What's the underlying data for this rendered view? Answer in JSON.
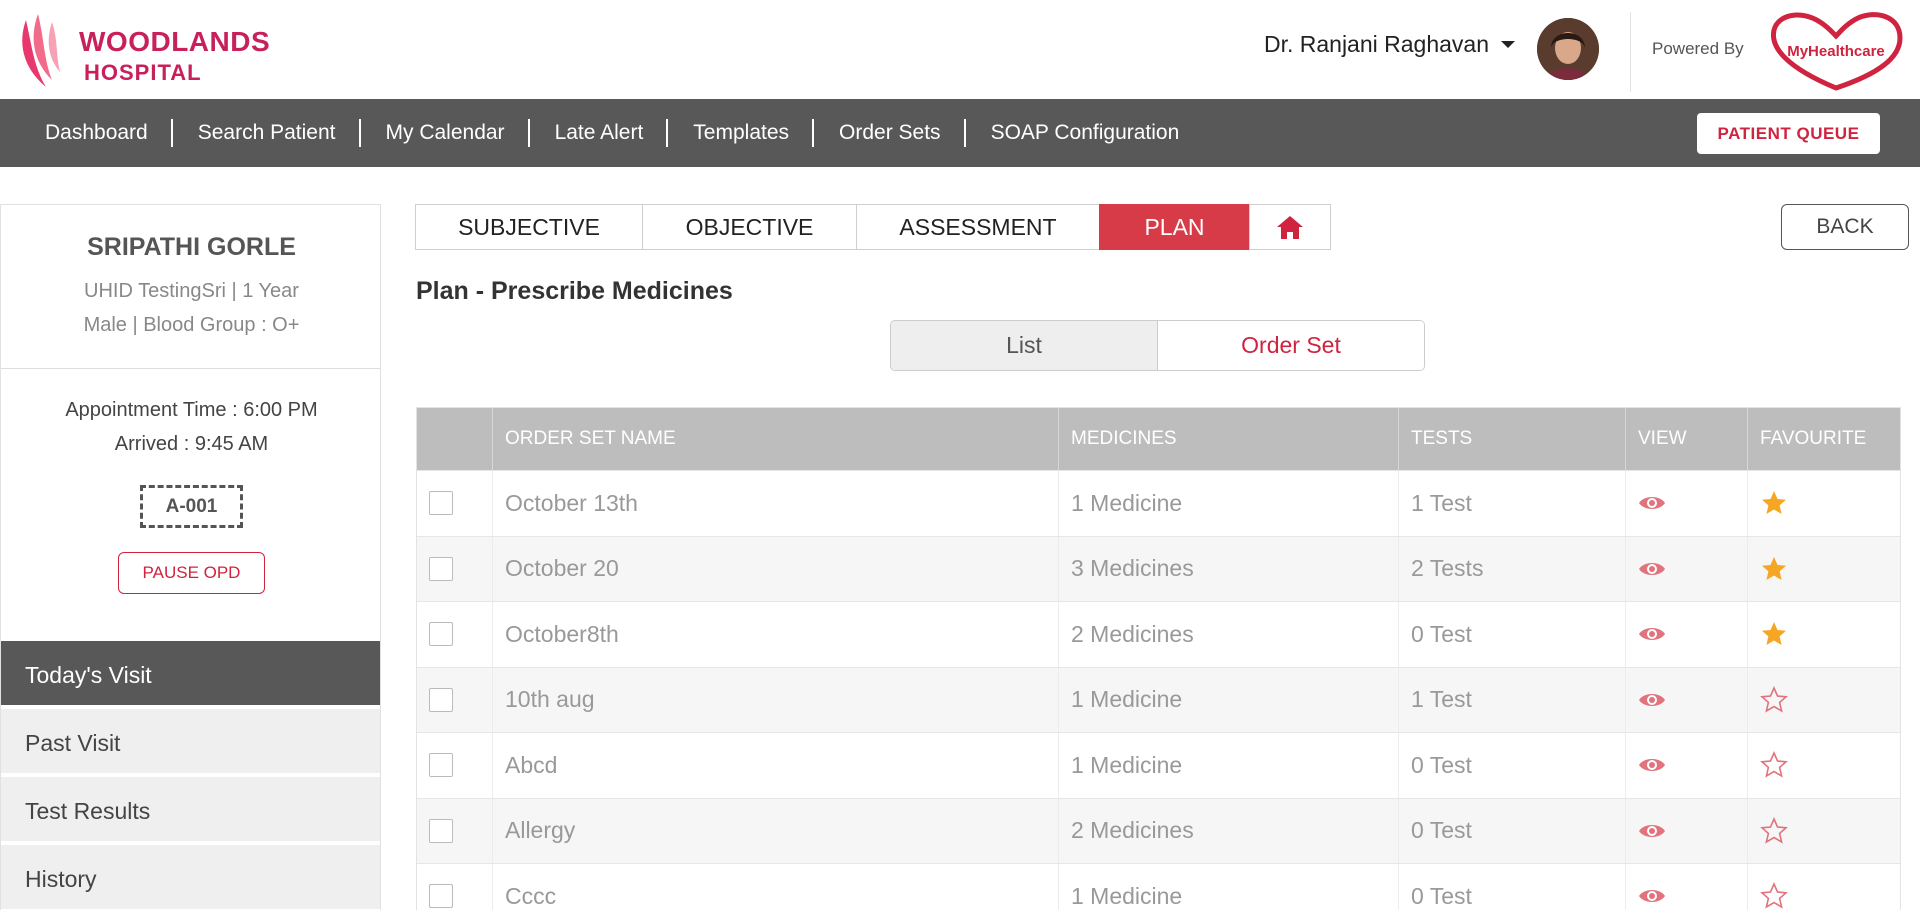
{
  "header": {
    "logo_line1": "WOODLANDS",
    "logo_line2": "HOSPITAL",
    "doctor_name": "Dr. Ranjani Raghavan",
    "powered_by": "Powered By",
    "partner_logo_text": "MyHealthcare"
  },
  "nav": {
    "items": [
      "Dashboard",
      "Search Patient",
      "My Calendar",
      "Late Alert",
      "Templates",
      "Order Sets",
      "SOAP Configuration"
    ],
    "queue_button": "PATIENT QUEUE"
  },
  "patient": {
    "name": "SRIPATHI GORLE",
    "uhid_line": "UHID TestingSri | 1 Year",
    "gender_line": "Male | Blood Group : O+",
    "appointment": "Appointment Time : 6:00 PM",
    "arrived": "Arrived : 9:45 AM",
    "token": "A-001",
    "pause_button": "PAUSE OPD"
  },
  "side_nav": [
    "Today's Visit",
    "Past Visit",
    "Test Results",
    "History"
  ],
  "tabs": [
    "SUBJECTIVE",
    "OBJECTIVE",
    "ASSESSMENT",
    "PLAN"
  ],
  "back_button": "BACK",
  "section_title": "Plan - Prescribe Medicines",
  "toggle": {
    "list": "List",
    "order_set": "Order Set"
  },
  "table": {
    "headers": [
      "ORDER SET NAME",
      "MEDICINES",
      "TESTS",
      "VIEW",
      "FAVOURITE"
    ],
    "rows": [
      {
        "name": "October 13th",
        "medicines": "1 Medicine",
        "tests": "1 Test",
        "favourite": true
      },
      {
        "name": "October 20",
        "medicines": "3 Medicines",
        "tests": "2 Tests",
        "favourite": true
      },
      {
        "name": "October8th",
        "medicines": "2 Medicines",
        "tests": "0 Test",
        "favourite": true
      },
      {
        "name": "10th aug",
        "medicines": "1 Medicine",
        "tests": "1 Test",
        "favourite": false
      },
      {
        "name": "Abcd",
        "medicines": "1 Medicine",
        "tests": "0 Test",
        "favourite": false
      },
      {
        "name": "Allergy",
        "medicines": "2 Medicines",
        "tests": "0 Test",
        "favourite": false
      },
      {
        "name": "Cccc",
        "medicines": "1 Medicine",
        "tests": "0 Test",
        "favourite": false
      }
    ]
  },
  "colors": {
    "brand": "#c8205b",
    "accent": "#d73b48",
    "nav_bg": "#585858",
    "star": "#f5a623",
    "eye": "#e0737d"
  }
}
